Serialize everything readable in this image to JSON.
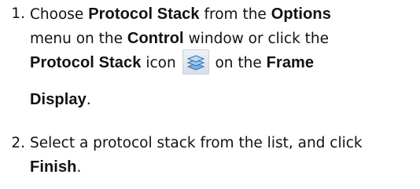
{
  "steps": [
    {
      "number": "1.",
      "parts": {
        "t1": "Choose ",
        "b1": "Protocol Stack",
        "t2": " from the ",
        "b2": "Options",
        "t3": " menu on the ",
        "b3": "Control",
        "t4": " window or click the ",
        "b4": "Protocol Stack",
        "t5": " icon ",
        "icon": "protocol-stack-icon",
        "t6": " on the ",
        "b5": "Frame",
        "b6": "Display",
        "t7": "."
      }
    },
    {
      "number": "2.",
      "parts": {
        "t1": "Select a protocol stack from the list, and click ",
        "b1": "Finish",
        "t2": "."
      }
    }
  ]
}
